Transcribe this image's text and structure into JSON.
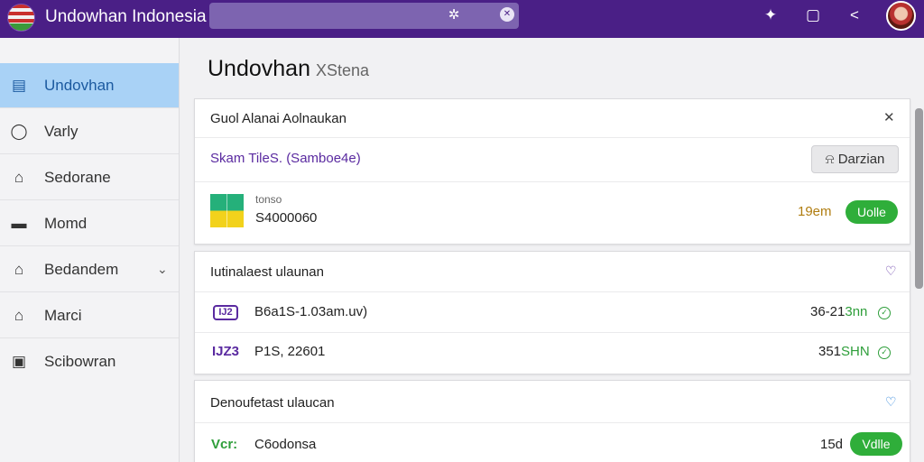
{
  "header": {
    "brand": "Undowhan Indonesia",
    "icons": [
      "flag-icon",
      "search-icon",
      "clear-icon",
      "pin-icon",
      "tablet-icon",
      "share-icon",
      "avatar"
    ]
  },
  "sidebar": {
    "items": [
      {
        "label": "Undovhan",
        "icon": "home-icon",
        "active": true
      },
      {
        "label": "Varly",
        "icon": "circle-icon"
      },
      {
        "label": "Sedorane",
        "icon": "house-icon"
      },
      {
        "label": "Momd",
        "icon": "card-icon"
      },
      {
        "label": "Bedandem",
        "icon": "house-icon",
        "expandable": true
      },
      {
        "label": "Marci",
        "icon": "house-icon"
      },
      {
        "label": "Scibowran",
        "icon": "window-icon"
      }
    ]
  },
  "main": {
    "title": "Undovhan",
    "subtitle": "XStena",
    "card1": {
      "title": "Guol Alanai Aolnaukan",
      "row_link": "Skam TileS. (Samboe4e)",
      "button": "Darzian",
      "entry_label": "tonso",
      "entry_value": "S4000060",
      "time": "19em",
      "status": "Uolle"
    },
    "card2": {
      "title": "Iutinalaest ulaunan",
      "rows": [
        {
          "code": "IJ2",
          "text": "B6a1S-1.03am.uv)",
          "value": "36-21",
          "value_suffix": "3nn"
        },
        {
          "code": "IJZ3",
          "text": "P1S, 22601",
          "value": "351",
          "value_suffix": "SHN"
        }
      ]
    },
    "card3": {
      "title": "Denoufetast ulaucan",
      "row": {
        "code": "Vcr:",
        "text": "C6odonsa",
        "value": "15d",
        "status": "Vdlle"
      }
    }
  },
  "colors": {
    "topbar": "#4a1f86",
    "sidebar_active": "#a9d2f6",
    "accent_purple": "#5a2aa0",
    "status_green": "#2fae3a",
    "time_gold": "#b07d10"
  }
}
